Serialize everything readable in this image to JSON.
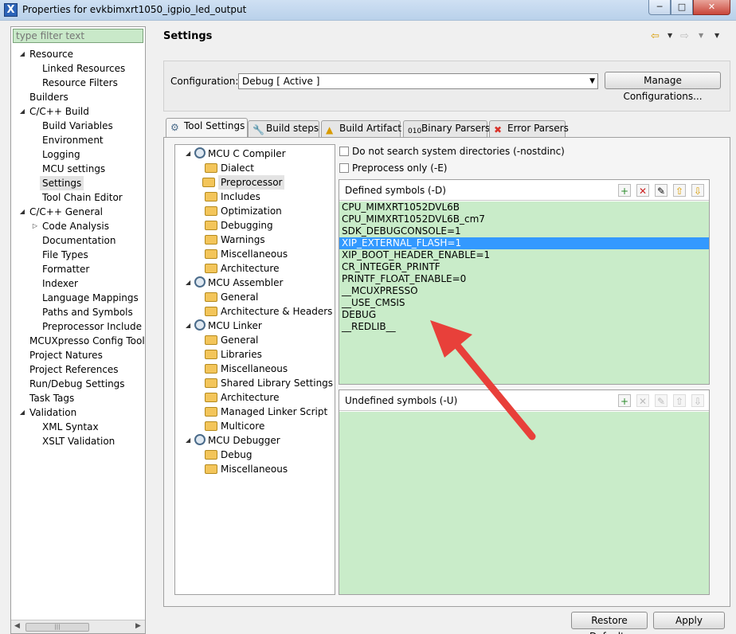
{
  "window": {
    "title": "Properties for evkbimxrt1050_igpio_led_output",
    "app_icon": "X"
  },
  "filter": {
    "placeholder": "type filter text"
  },
  "nav": [
    {
      "label": "Resource",
      "level": 1,
      "expanded": true
    },
    {
      "label": "Linked Resources",
      "level": 2
    },
    {
      "label": "Resource Filters",
      "level": 2
    },
    {
      "label": "Builders",
      "level": 1
    },
    {
      "label": "C/C++ Build",
      "level": 1,
      "expanded": true
    },
    {
      "label": "Build Variables",
      "level": 2
    },
    {
      "label": "Environment",
      "level": 2
    },
    {
      "label": "Logging",
      "level": 2
    },
    {
      "label": "MCU settings",
      "level": 2
    },
    {
      "label": "Settings",
      "level": 2,
      "selected": true
    },
    {
      "label": "Tool Chain Editor",
      "level": 2
    },
    {
      "label": "C/C++ General",
      "level": 1,
      "expanded": true
    },
    {
      "label": "Code Analysis",
      "level": 2,
      "collapsed": true
    },
    {
      "label": "Documentation",
      "level": 2
    },
    {
      "label": "File Types",
      "level": 2
    },
    {
      "label": "Formatter",
      "level": 2
    },
    {
      "label": "Indexer",
      "level": 2
    },
    {
      "label": "Language Mappings",
      "level": 2
    },
    {
      "label": "Paths and Symbols",
      "level": 2
    },
    {
      "label": "Preprocessor Include Pat",
      "level": 2
    },
    {
      "label": "MCUXpresso Config Tools",
      "level": 1
    },
    {
      "label": "Project Natures",
      "level": 1
    },
    {
      "label": "Project References",
      "level": 1
    },
    {
      "label": "Run/Debug Settings",
      "level": 1
    },
    {
      "label": "Task Tags",
      "level": 1
    },
    {
      "label": "Validation",
      "level": 1,
      "expanded": true
    },
    {
      "label": "XML Syntax",
      "level": 2
    },
    {
      "label": "XSLT Validation",
      "level": 2
    }
  ],
  "header": {
    "title": "Settings"
  },
  "config": {
    "label": "Configuration:",
    "value": "Debug  [ Active ]",
    "manage_label": "Manage Configurations..."
  },
  "tabs": [
    {
      "label": "Tool Settings",
      "icon": "gear-icon",
      "active": true
    },
    {
      "label": "Build steps",
      "icon": "wrench-icon"
    },
    {
      "label": "Build Artifact",
      "icon": "artifact-icon"
    },
    {
      "label": "Binary Parsers",
      "icon": "binary-icon"
    },
    {
      "label": "Error Parsers",
      "icon": "error-icon"
    }
  ],
  "tool_tree": [
    {
      "label": "MCU C Compiler",
      "level": 1
    },
    {
      "label": "Dialect",
      "level": 2
    },
    {
      "label": "Preprocessor",
      "level": 2,
      "selected": true
    },
    {
      "label": "Includes",
      "level": 2
    },
    {
      "label": "Optimization",
      "level": 2
    },
    {
      "label": "Debugging",
      "level": 2
    },
    {
      "label": "Warnings",
      "level": 2
    },
    {
      "label": "Miscellaneous",
      "level": 2
    },
    {
      "label": "Architecture",
      "level": 2
    },
    {
      "label": "MCU Assembler",
      "level": 1
    },
    {
      "label": "General",
      "level": 2
    },
    {
      "label": "Architecture & Headers",
      "level": 2
    },
    {
      "label": "MCU Linker",
      "level": 1
    },
    {
      "label": "General",
      "level": 2
    },
    {
      "label": "Libraries",
      "level": 2
    },
    {
      "label": "Miscellaneous",
      "level": 2
    },
    {
      "label": "Shared Library Settings",
      "level": 2
    },
    {
      "label": "Architecture",
      "level": 2
    },
    {
      "label": "Managed Linker Script",
      "level": 2
    },
    {
      "label": "Multicore",
      "level": 2
    },
    {
      "label": "MCU Debugger",
      "level": 1
    },
    {
      "label": "Debug",
      "level": 2
    },
    {
      "label": "Miscellaneous",
      "level": 2
    }
  ],
  "options": {
    "nostdinc": "Do not search system directories (-nostdinc)",
    "preprocess_only": "Preprocess only (-E)"
  },
  "defined": {
    "title": "Defined symbols (-D)",
    "items": [
      "CPU_MIMXRT1052DVL6B",
      "CPU_MIMXRT1052DVL6B_cm7",
      "SDK_DEBUGCONSOLE=1",
      "XIP_EXTERNAL_FLASH=1",
      "XIP_BOOT_HEADER_ENABLE=1",
      "CR_INTEGER_PRINTF",
      "PRINTF_FLOAT_ENABLE=0",
      "__MCUXPRESSO",
      "__USE_CMSIS",
      "DEBUG",
      "__REDLIB__"
    ],
    "selected_index": 3
  },
  "undefined": {
    "title": "Undefined symbols (-U)",
    "items": []
  },
  "buttons": {
    "restore": "Restore Defaults",
    "apply": "Apply"
  },
  "colors": {
    "accent": "#3399ff",
    "list_bg": "#c9ecc9",
    "arrow": "#e8403a"
  }
}
